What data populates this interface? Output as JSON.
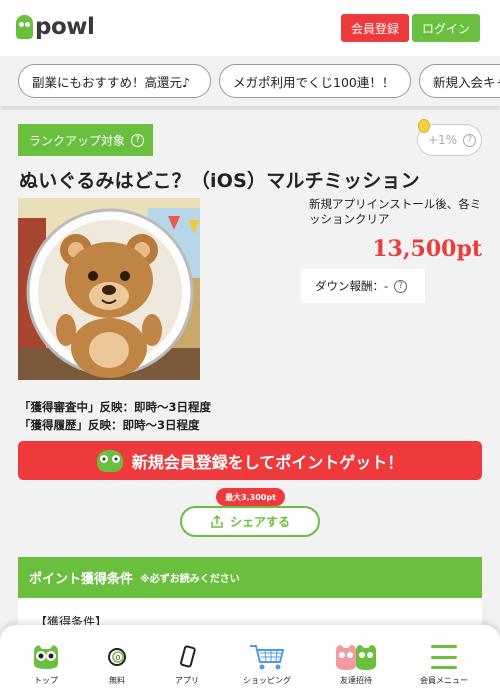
{
  "header": {
    "logo_text": "powl",
    "register_label": "会員登録",
    "login_label": "ログイン"
  },
  "chips": [
    {
      "label": "副業にもおすすめ！高還元♪"
    },
    {
      "label": "メガポ利用でくじ100連！！"
    },
    {
      "label": "新規入会キャンペーン"
    }
  ],
  "offer": {
    "rank_tag": "ランクアップ対象",
    "bonus": "+1%",
    "title": "ぬいぐるみはどこ？（iOS）マルチミッション",
    "condition_text": "新規アプリインストール後、各ミッションクリア",
    "points": "13,500pt",
    "down_reward": "ダウン報酬：-",
    "note_1": "「獲得審査中」反映：即時～3日程度",
    "note_2": "「獲得履歴」反映：即時～3日程度",
    "cta_label": "新規会員登録をしてポイントゲット！",
    "max_badge": "最大3,300pt",
    "share_label": "シェアする"
  },
  "conditions": {
    "heading": "ポイント獲得条件",
    "heading_note": "※必ずお読みください",
    "body_label": "【獲得条件】"
  },
  "bottom_nav": [
    {
      "label": "トップ",
      "icon": "owl-icon"
    },
    {
      "label": "無料",
      "icon": "free-icon"
    },
    {
      "label": "アプリ",
      "icon": "smartphone-icon"
    },
    {
      "label": "ショッピング",
      "icon": "cart-icon"
    },
    {
      "label": "友達招待",
      "icon": "invite-icon"
    },
    {
      "label": "会員メニュー",
      "icon": "menu-icon"
    }
  ],
  "colors": {
    "brand_green": "#6bbf3f",
    "accent_red": "#ef3a3d"
  }
}
